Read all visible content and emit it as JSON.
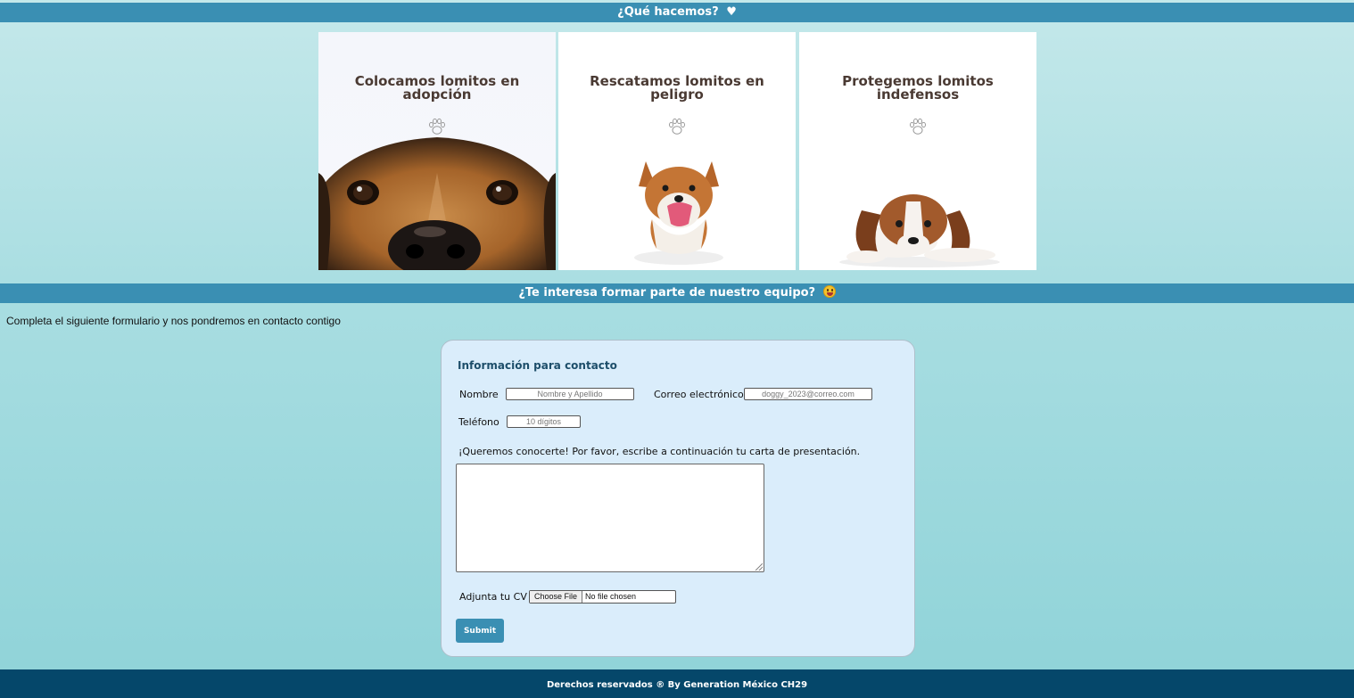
{
  "header": {
    "title": "¿Qué hacemos?",
    "icon": "heart-icon"
  },
  "cards": [
    {
      "title": "Colocamos lomitos en adopción",
      "icon": "paw-icon"
    },
    {
      "title": "Rescatamos lomitos en peligro",
      "icon": "paw-icon"
    },
    {
      "title": "Protegemos lomitos indefensos",
      "icon": "paw-icon"
    }
  ],
  "section2": {
    "title": "¿Te interesa formar parte de nuestro equipo?",
    "icon": "smiley-icon"
  },
  "intro": "Completa el siguiente formulario y nos pondremos en contacto contigo",
  "form": {
    "title": "Información para contacto",
    "name_label": "Nombre",
    "name_placeholder": "Nombre y Apellido",
    "email_label": "Correo electrónico",
    "email_placeholder": "doggy_2023@correo.com",
    "phone_label": "Teléfono",
    "phone_placeholder": "10 dígitos",
    "letter_label": "¡Queremos conocerte! Por favor, escribe a continuación tu carta de presentación.",
    "cv_label": "Adjunta tu CV",
    "file_button": "Choose File",
    "file_status": "No file chosen",
    "submit_label": "Submit"
  },
  "footer": {
    "text": "Derechos reservados ® By Generation México CH29"
  },
  "colors": {
    "bar": "#3a8fb3",
    "footer": "#05476a",
    "form_bg": "#daedfb"
  }
}
